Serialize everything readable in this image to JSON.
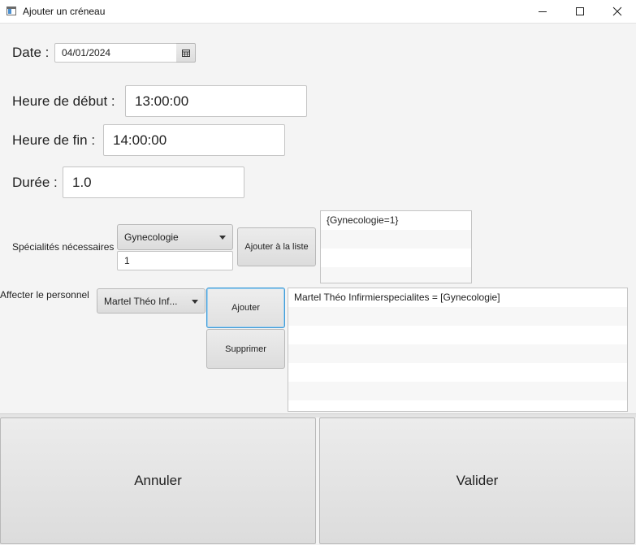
{
  "window": {
    "title": "Ajouter un créneau",
    "minimize_icon": "minimize-icon",
    "maximize_icon": "maximize-icon",
    "close_icon": "close-icon"
  },
  "form": {
    "date_label": "Date :",
    "date_value": "04/01/2024",
    "calendar_icon": "calendar-icon",
    "start_label": "Heure de début :",
    "start_value": "13:00:00",
    "end_label": "Heure de fin :",
    "end_value": "14:00:00",
    "duration_label": "Durée :",
    "duration_value": "1.0"
  },
  "specialties": {
    "label": "Spécialités nécessaires",
    "selected": "Gynecologie",
    "count_value": "1",
    "add_button": "Ajouter à la liste",
    "items": [
      "{Gynecologie=1}",
      "",
      "",
      ""
    ]
  },
  "staff": {
    "label": "Affecter le personnel",
    "selected": "Martel Théo Inf...",
    "add_button": "Ajouter",
    "remove_button": "Supprimer",
    "items": [
      "Martel Théo Infirmierspecialites = [Gynecologie]",
      "",
      "",
      "",
      "",
      "",
      ""
    ]
  },
  "footer": {
    "cancel": "Annuler",
    "validate": "Valider"
  },
  "colors": {
    "background": "#f4f4f4",
    "focus_border": "#3c9ad7"
  }
}
